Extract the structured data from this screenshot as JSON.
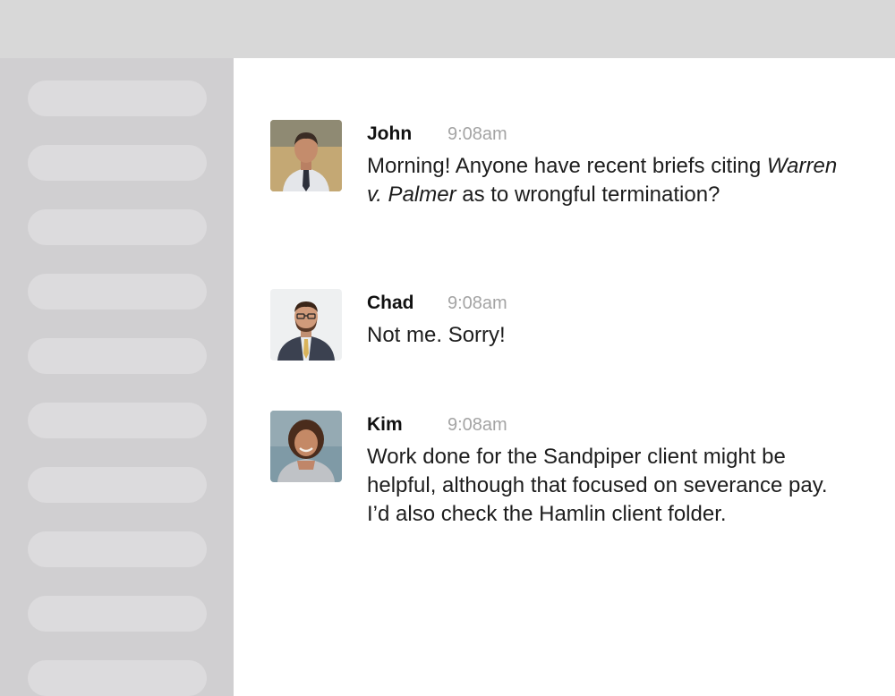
{
  "sidebar": {
    "items": [
      {
        "label": ""
      },
      {
        "label": ""
      },
      {
        "label": ""
      },
      {
        "label": ""
      },
      {
        "label": ""
      },
      {
        "label": ""
      },
      {
        "label": ""
      },
      {
        "label": ""
      },
      {
        "label": ""
      },
      {
        "label": ""
      }
    ]
  },
  "messages": [
    {
      "author": "John",
      "time": "9:08am",
      "text_before": "Morning! Anyone have recent briefs citing ",
      "text_italic": "Warren v. Palmer",
      "text_after": " as to wrongful termination?"
    },
    {
      "author": "Chad",
      "time": "9:08am",
      "text": "Not me. Sorry!"
    },
    {
      "author": "Kim",
      "time": "9:08am",
      "text": "Work done for the Sandpiper client might be helpful, although that focused on severance pay. I’d also check the Hamlin client folder."
    }
  ],
  "colors": {
    "topbar": "#d8d8d8",
    "sidebar": "#d0cfd1",
    "sidebar_item": "#dcdbdd",
    "timestamp": "#a4a4a4"
  }
}
